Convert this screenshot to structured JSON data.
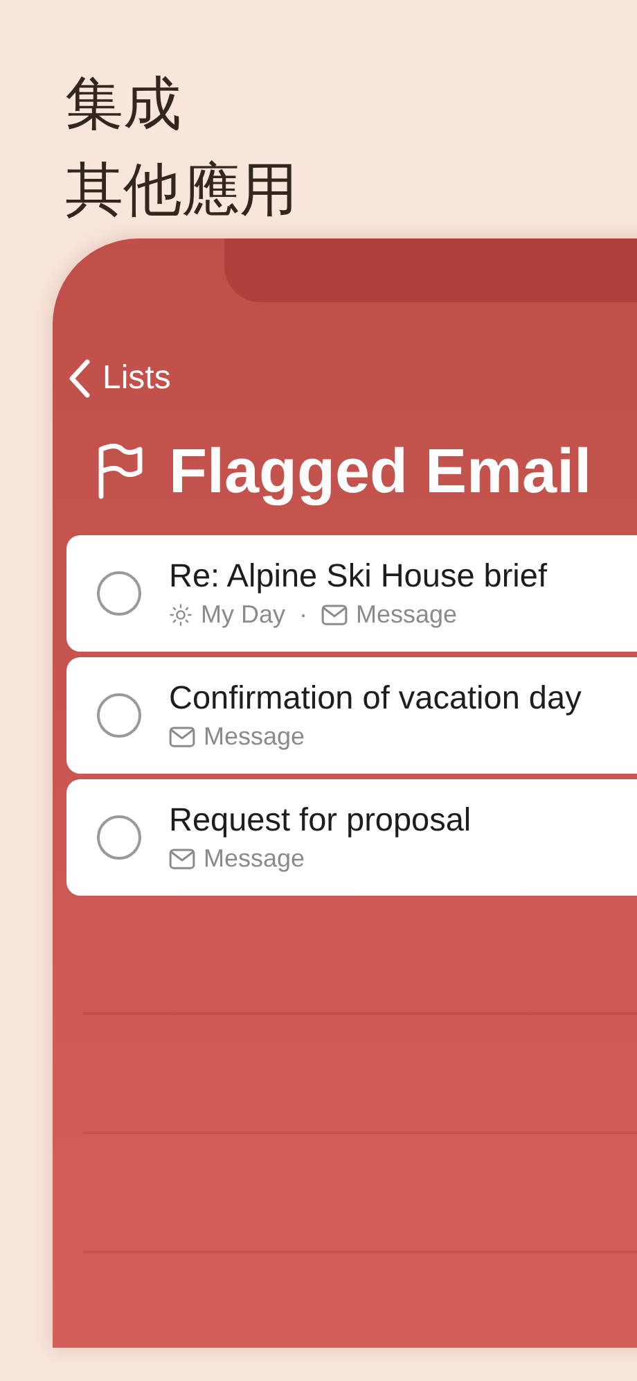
{
  "heading": {
    "lines": [
      "集成",
      "其他應用"
    ]
  },
  "nav": {
    "back_label": "Lists"
  },
  "list": {
    "title": "Flagged Email"
  },
  "meta_separator": "·",
  "tasks": [
    {
      "title": "Re: Alpine Ski House brief",
      "completed": false,
      "meta": [
        {
          "kind": "my_day",
          "label": "My Day"
        },
        {
          "kind": "message",
          "label": "Message"
        }
      ]
    },
    {
      "title": "Confirmation of vacation day",
      "completed": false,
      "meta": [
        {
          "kind": "message",
          "label": "Message"
        }
      ]
    },
    {
      "title": "Request for proposal",
      "completed": false,
      "meta": [
        {
          "kind": "message",
          "label": "Message"
        }
      ]
    }
  ]
}
